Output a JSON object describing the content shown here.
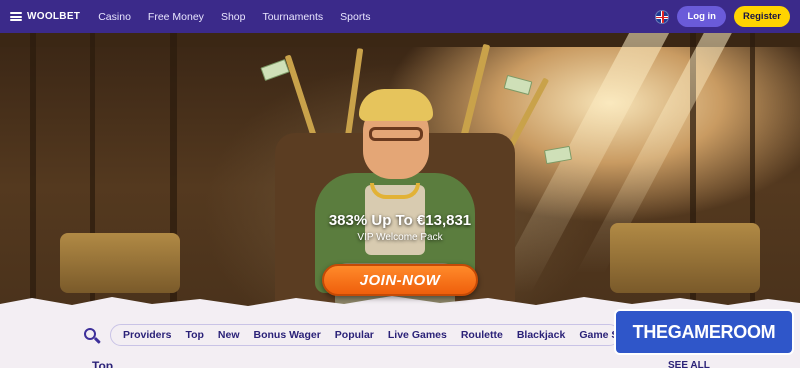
{
  "header": {
    "logo": "WOOLBET",
    "nav": [
      "Casino",
      "Free Money",
      "Shop",
      "Tournaments",
      "Sports"
    ],
    "login_label": "Log in",
    "register_label": "Register"
  },
  "hero": {
    "promo_title": "383% Up To €13,831",
    "promo_subtitle": "VIP Welcome Pack",
    "join_label": "JOIN-NOW"
  },
  "categories": [
    "Providers",
    "Top",
    "New",
    "Bonus Wager",
    "Popular",
    "Live Games",
    "Roulette",
    "Blackjack",
    "Game Shows"
  ],
  "section": {
    "title": "Top",
    "see_all": "SEE ALL"
  },
  "watermark": "THEGAMEROOM",
  "colors": {
    "topbar": "#3b2a8a",
    "register": "#ffd400",
    "join": "#ef5f0c",
    "accent_text": "#2b2278"
  }
}
